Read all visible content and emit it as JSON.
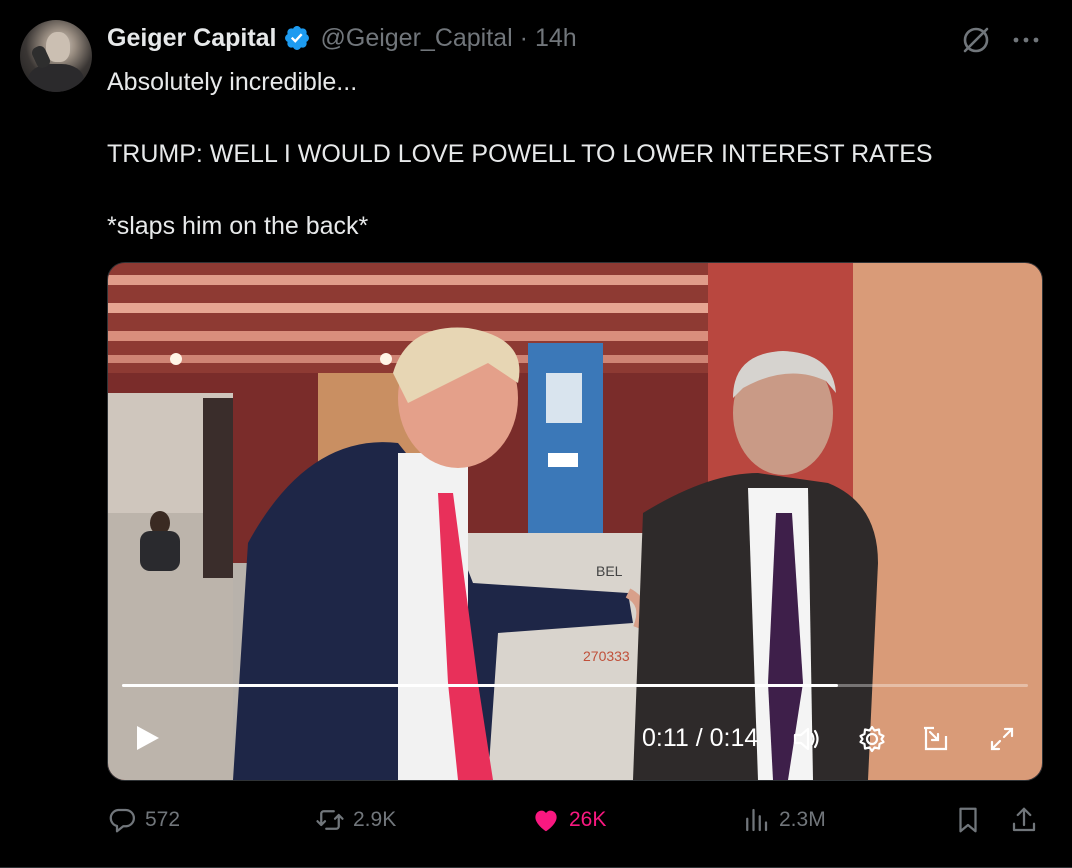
{
  "author": {
    "display_name": "Geiger Capital",
    "handle": "@Geiger_Capital",
    "separator": "·",
    "time": "14h",
    "verified": true
  },
  "tweet": {
    "lines": [
      "Absolutely incredible...",
      "",
      "TRUMP: WELL I WOULD LOVE POWELL TO LOWER INTEREST RATES",
      "",
      "*slaps him on the back*"
    ]
  },
  "video": {
    "timecode": "0:11 / 0:14",
    "progress": 0.79,
    "box_label": "BEL",
    "box_number": "270333"
  },
  "actions": {
    "replies": "572",
    "retweets": "2.9K",
    "likes": "26K",
    "views": "2.3M"
  },
  "icons": {
    "verified": "verified-badge-icon",
    "grok": "grok-icon",
    "more": "more-options-icon",
    "play": "play-icon",
    "volume": "volume-icon",
    "settings": "settings-gear-icon",
    "pip": "picture-in-picture-icon",
    "fullscreen": "fullscreen-icon",
    "reply": "reply-icon",
    "retweet": "retweet-icon",
    "like": "heart-icon",
    "views": "views-bar-icon",
    "bookmark": "bookmark-icon",
    "share": "share-icon"
  },
  "colors": {
    "background": "#000000",
    "text": "#e7e9ea",
    "muted": "#71767b",
    "verified": "#1d9bf0",
    "like": "#f91880"
  }
}
